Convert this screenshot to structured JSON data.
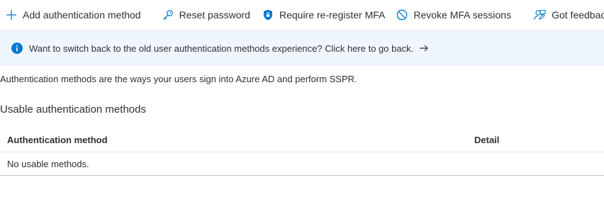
{
  "toolbar": {
    "add_label": "Add authentication method",
    "reset_label": "Reset password",
    "reregister_label": "Require re-register MFA",
    "revoke_label": "Revoke MFA sessions",
    "feedback_label": "Got feedback?"
  },
  "banner": {
    "text": "Want to switch back to the old user authentication methods experience? Click here to go back."
  },
  "description": "Authentication methods are the ways your users sign into Azure AD and perform SSPR.",
  "section": {
    "title": "Usable authentication methods",
    "table": {
      "columns": [
        "Authentication method",
        "Detail"
      ],
      "empty_text": "No usable methods."
    }
  },
  "colors": {
    "accent": "#0078d4",
    "banner_bg": "#f0f6ff"
  },
  "icons": {
    "add": "plus-icon",
    "reset": "key-icon",
    "reregister": "shield-icon",
    "revoke": "block-icon",
    "feedback": "feedback-person-icon",
    "info": "info-icon",
    "arrow": "arrow-right-icon"
  }
}
